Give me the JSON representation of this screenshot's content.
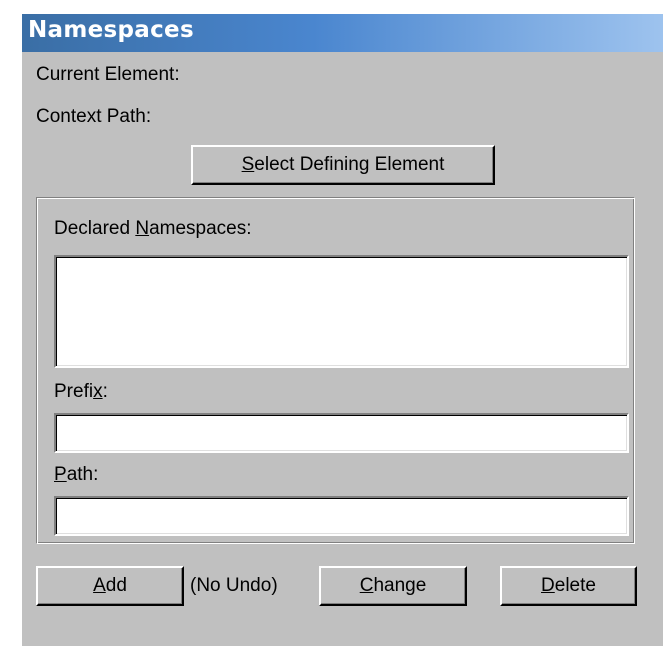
{
  "window": {
    "title": "Namespaces"
  },
  "labels": {
    "current_element": "Current Element:",
    "context_path": "Context Path:",
    "no_undo": "(No Undo)"
  },
  "select_defining_button": {
    "mnemonic": "S",
    "rest": "elect Defining Element"
  },
  "declared_namespaces": {
    "before": "Declared ",
    "mnemonic": "N",
    "after": "amespaces:",
    "items": []
  },
  "prefix": {
    "before": "Prefi",
    "mnemonic": "x",
    "after": ":",
    "value": ""
  },
  "path": {
    "before": "",
    "mnemonic": "P",
    "after": "ath:",
    "value": ""
  },
  "buttons": {
    "add": {
      "mnemonic": "A",
      "rest": "dd"
    },
    "change": {
      "mnemonic": "C",
      "rest": "hange"
    },
    "delete": {
      "mnemonic": "D",
      "rest": "elete"
    }
  },
  "colors": {
    "title_gradient_start": "#3a6ea5",
    "title_gradient_end": "#9fc4ef",
    "panel_background": "#c0c0c0"
  }
}
